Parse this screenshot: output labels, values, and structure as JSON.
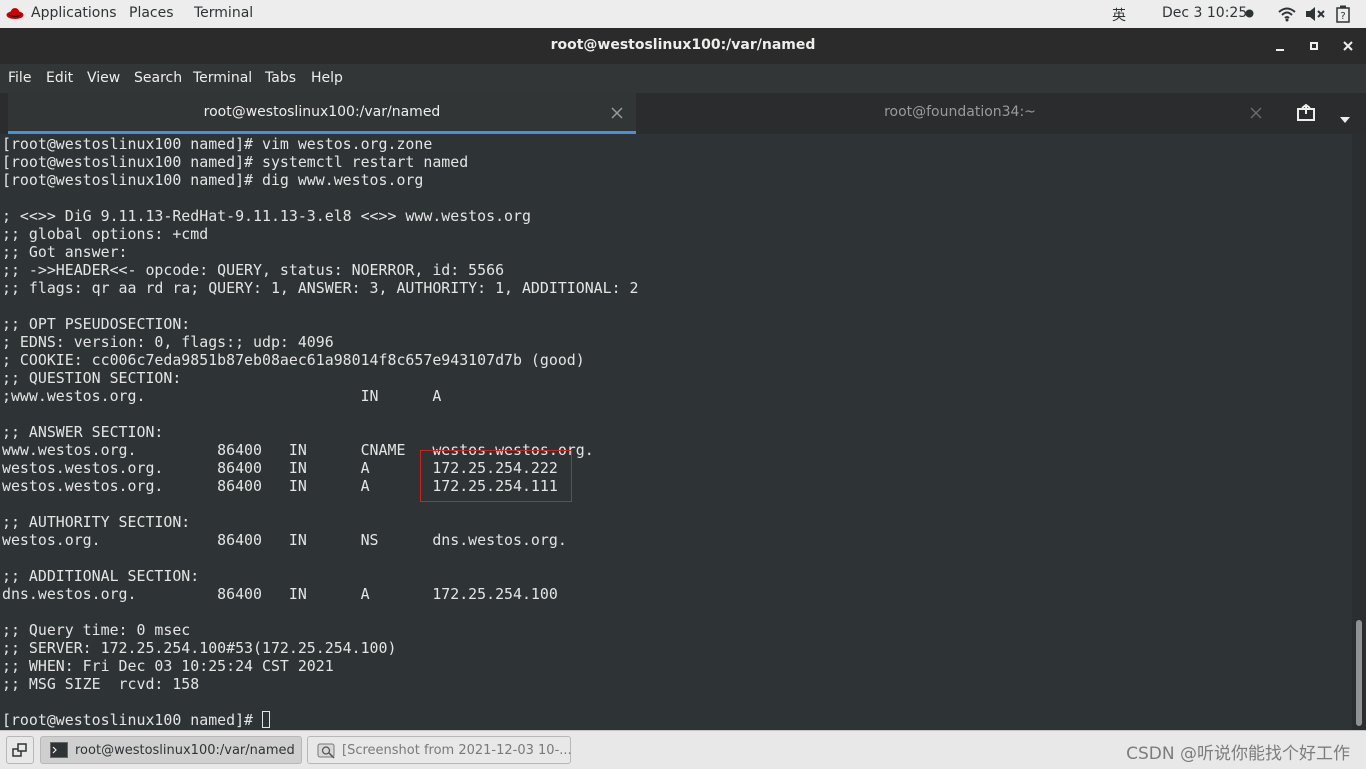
{
  "topbar": {
    "applications": "Applications",
    "places": "Places",
    "terminal": "Terminal",
    "input_method": "英",
    "clock": "Dec 3  10:25"
  },
  "window": {
    "title": "root@westoslinux100:/var/named"
  },
  "menu": [
    "File",
    "Edit",
    "View",
    "Search",
    "Terminal",
    "Tabs",
    "Help"
  ],
  "tabs": [
    {
      "label": "root@westoslinux100:/var/named",
      "active": true
    },
    {
      "label": "root@foundation34:~",
      "active": false
    }
  ],
  "terminal": {
    "lines": [
      "[root@westoslinux100 named]# vim westos.org.zone",
      "[root@westoslinux100 named]# systemctl restart named",
      "[root@westoslinux100 named]# dig www.westos.org",
      "",
      "; <<>> DiG 9.11.13-RedHat-9.11.13-3.el8 <<>> www.westos.org",
      ";; global options: +cmd",
      ";; Got answer:",
      ";; ->>HEADER<<- opcode: QUERY, status: NOERROR, id: 5566",
      ";; flags: qr aa rd ra; QUERY: 1, ANSWER: 3, AUTHORITY: 1, ADDITIONAL: 2",
      "",
      ";; OPT PSEUDOSECTION:",
      "; EDNS: version: 0, flags:; udp: 4096",
      "; COOKIE: cc006c7eda9851b87eb08aec61a98014f8c657e943107d7b (good)",
      ";; QUESTION SECTION:",
      ";www.westos.org.                        IN      A",
      "",
      ";; ANSWER SECTION:",
      "www.westos.org.         86400   IN      CNAME   westos.westos.org.",
      "westos.westos.org.      86400   IN      A       172.25.254.222",
      "westos.westos.org.      86400   IN      A       172.25.254.111",
      "",
      ";; AUTHORITY SECTION:",
      "westos.org.             86400   IN      NS      dns.westos.org.",
      "",
      ";; ADDITIONAL SECTION:",
      "dns.westos.org.         86400   IN      A       172.25.254.100",
      "",
      ";; Query time: 0 msec",
      ";; SERVER: 172.25.254.100#53(172.25.254.100)",
      ";; WHEN: Fri Dec 03 10:25:24 CST 2021",
      ";; MSG SIZE  rcvd: 158",
      "",
      "[root@westoslinux100 named]# "
    ]
  },
  "taskbar": {
    "items": [
      {
        "label": "root@westoslinux100:/var/named",
        "icon": "terminal-icon",
        "active": true
      },
      {
        "label": "[Screenshot from 2021-12-03 10-...",
        "icon": "screenshot-icon",
        "active": false
      }
    ],
    "watermark": "CSDN @听说你能找个好工作"
  },
  "colors": {
    "terminal_bg": "#2e3436",
    "terminal_fg": "#e4e4e4",
    "tab_accent": "#4a90d9",
    "highlight_border": "#cc2222"
  }
}
